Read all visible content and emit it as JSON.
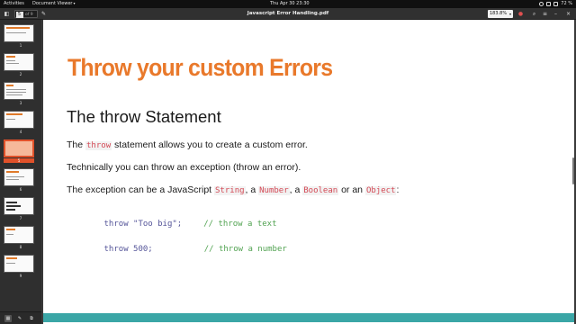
{
  "topbar": {
    "activities": "Activities",
    "app_menu": "Document Viewer",
    "clock": "Thu Apr 30  23:30",
    "battery": "72 %"
  },
  "header": {
    "page_current": "5",
    "page_of": "of 9",
    "title": "Javascript Error Handling.pdf",
    "zoom": "183.8%"
  },
  "sidebar": {
    "thumbnails": [
      "1",
      "2",
      "3",
      "4",
      "5",
      "6",
      "7",
      "8",
      "9"
    ],
    "selected": "5"
  },
  "slide": {
    "title": "Throw your custom Errors",
    "subtitle": "The throw Statement",
    "p1_pre": "The ",
    "p1_code": "throw",
    "p1_post": " statement allows you to create a custom error.",
    "p2": "Technically you can throw an exception (throw an error).",
    "p3_pre": "The exception can be a JavaScript ",
    "p3_c1": "String",
    "p3_s1": ", a ",
    "p3_c2": "Number",
    "p3_s2": ", a ",
    "p3_c3": "Boolean",
    "p3_s3": " or an ",
    "p3_c4": "Object",
    "p3_end": ":",
    "code1_kw": "throw",
    "code1_val": " \"Too big\";",
    "code1_comment": "// throw a text",
    "code2_kw": "throw",
    "code2_val": " 500;",
    "code2_comment": "// throw a number"
  },
  "colors": {
    "accent": "#e9792b",
    "selection": "#e0512a",
    "footer_band": "#3aa6a6"
  }
}
